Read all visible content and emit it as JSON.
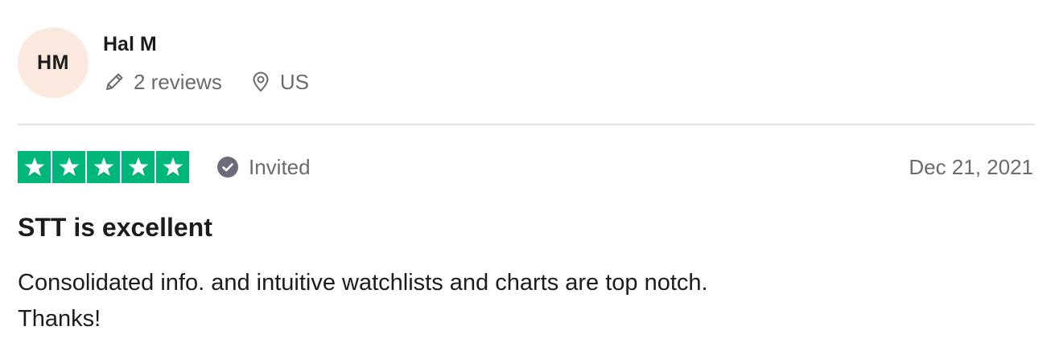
{
  "reviewer": {
    "initials": "HM",
    "name": "Hal M",
    "review_count": "2 reviews",
    "location": "US",
    "icons": {
      "reviews": "pencil-icon",
      "location": "map-pin-icon"
    },
    "avatar_color": "#fbe9e0"
  },
  "review": {
    "rating": 5,
    "max_rating": 5,
    "star_color": "#00b67a",
    "invited_label": "Invited",
    "invited_icon": "check-circle-icon",
    "date": "Dec 21, 2021",
    "title": "STT is excellent",
    "body_lines": [
      "Consolidated info. and intuitive watchlists and charts are top notch.",
      "Thanks!"
    ]
  }
}
